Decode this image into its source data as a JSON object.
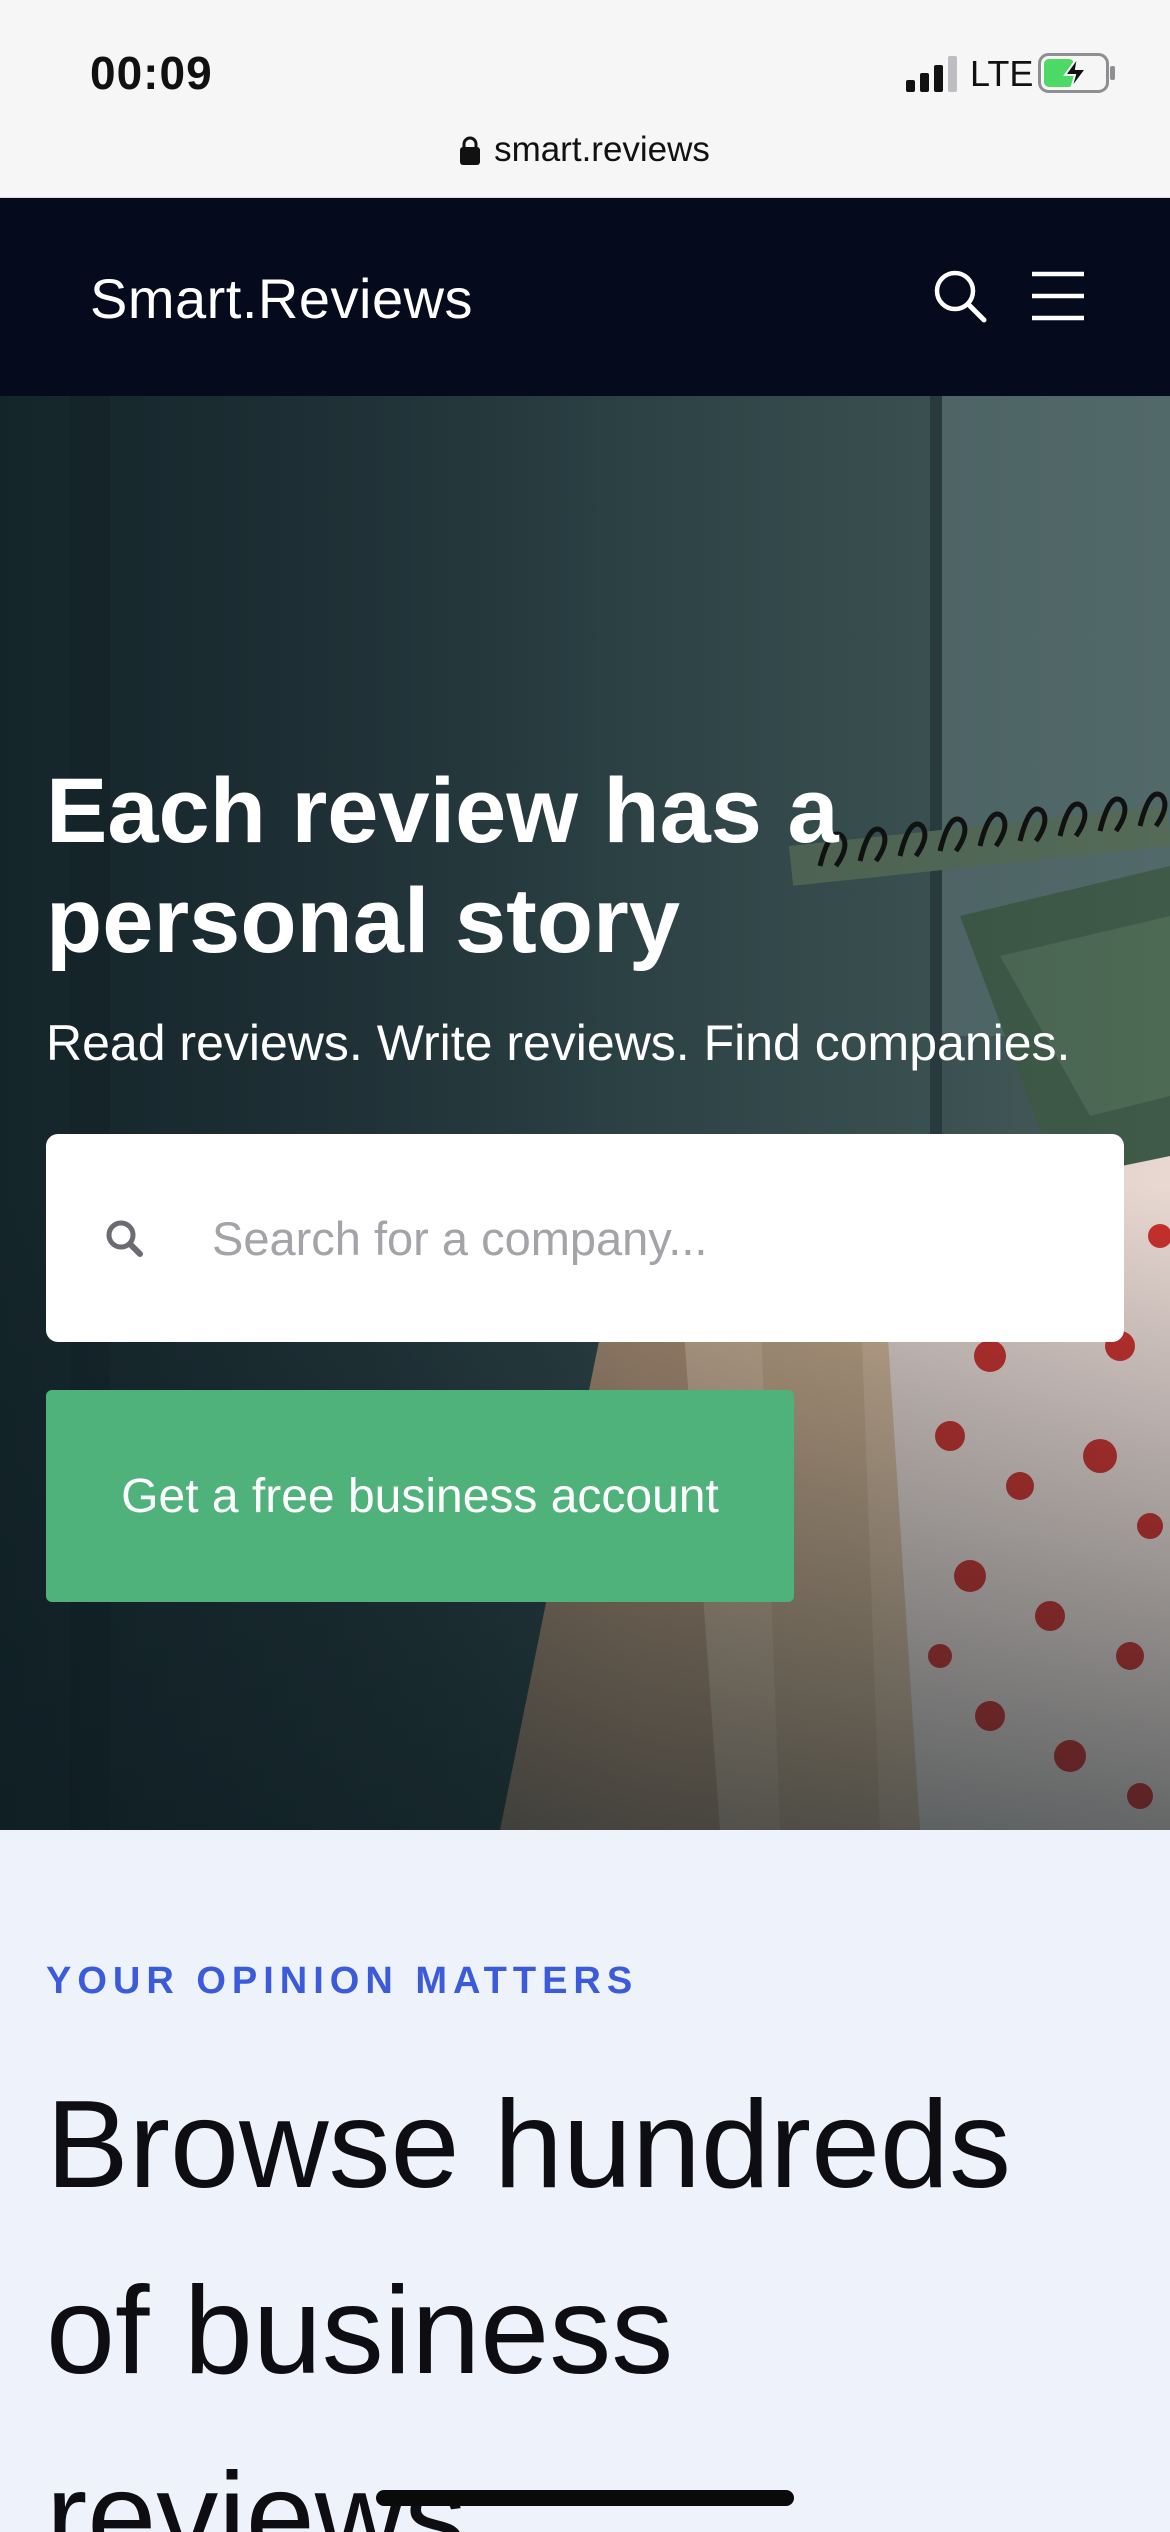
{
  "status_bar": {
    "time": "00:09",
    "network": "LTE",
    "battery_state": "charging"
  },
  "browser": {
    "url": "smart.reviews"
  },
  "navbar": {
    "logo": "Smart.Reviews",
    "icons": [
      "search-icon",
      "menu-icon"
    ],
    "background": "#050a1c"
  },
  "hero": {
    "title": "Each review has a personal story",
    "subtitle": "Read reviews. Write reviews. Find companies.",
    "search": {
      "placeholder": "Search for a company...",
      "value": ""
    },
    "cta_label": "Get a free business account",
    "cta_color": "#4fb27a"
  },
  "section": {
    "eyebrow": "YOUR OPINION MATTERS",
    "eyebrow_color": "#3b5bdb",
    "title": "Browse hundreds of business reviews"
  }
}
